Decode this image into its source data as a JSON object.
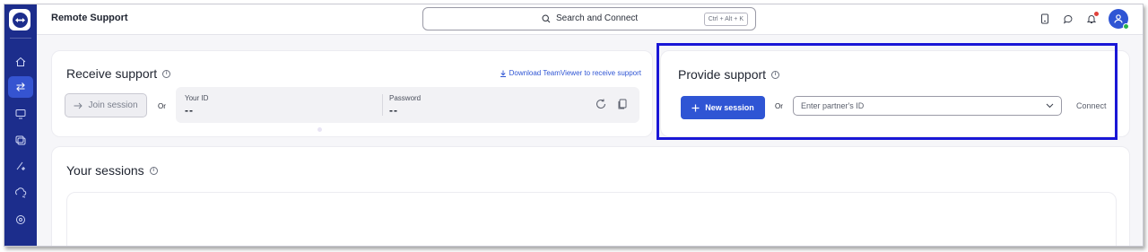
{
  "header": {
    "title": "Remote Support",
    "search_placeholder": "Search and Connect",
    "search_shortcut": "Ctrl + Alt + K",
    "icons": [
      "device-icon",
      "chat-icon",
      "bell-icon",
      "avatar"
    ]
  },
  "sidebar": {
    "items": [
      {
        "icon": "home-icon",
        "active": false
      },
      {
        "icon": "remote-support-icon",
        "active": true
      },
      {
        "icon": "devices-icon",
        "active": false
      },
      {
        "icon": "sessions-icon",
        "active": false
      },
      {
        "icon": "tools-icon",
        "active": false
      },
      {
        "icon": "cloud-connect-icon",
        "active": false
      },
      {
        "icon": "settings-icon",
        "active": false
      }
    ]
  },
  "receive": {
    "title": "Receive support",
    "download_link": "Download TeamViewer to receive support",
    "join_label": "Join session",
    "or": "Or",
    "your_id_label": "Your ID",
    "your_id_value": "--",
    "password_label": "Password",
    "password_value": "--"
  },
  "provide": {
    "title": "Provide support",
    "new_session_label": "New session",
    "or": "Or",
    "partner_placeholder": "Enter partner's ID",
    "connect_label": "Connect"
  },
  "sessions": {
    "title": "Your sessions"
  },
  "colors": {
    "sidebar": "#1c2d8c",
    "accent": "#2f55d4",
    "highlight": "#1a17d6"
  }
}
